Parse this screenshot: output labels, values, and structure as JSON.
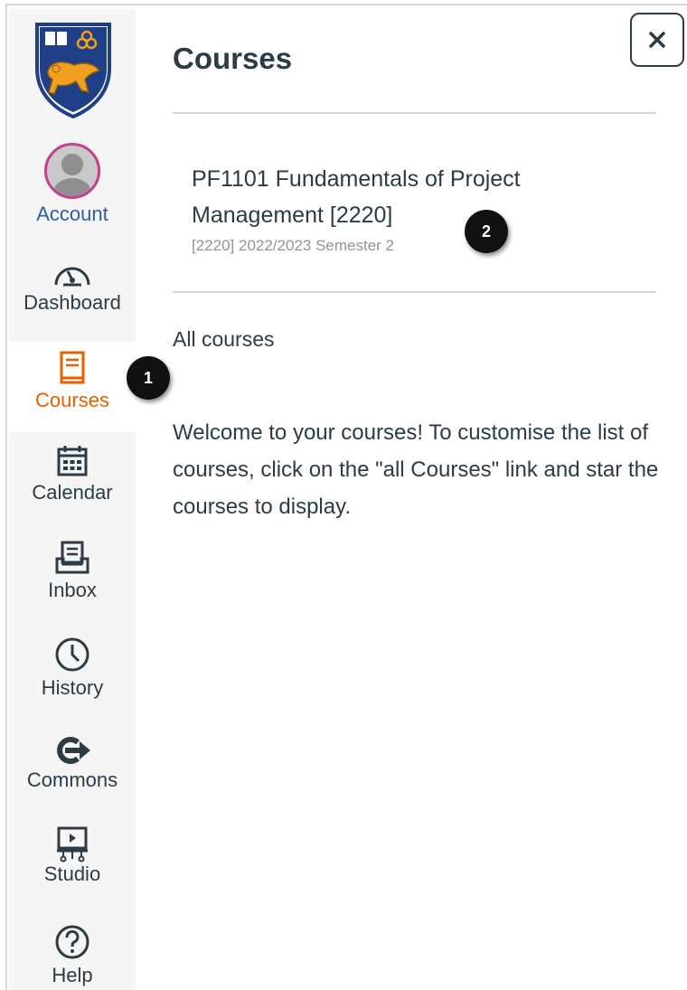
{
  "nav": {
    "account": "Account",
    "dashboard": "Dashboard",
    "courses": "Courses",
    "calendar": "Calendar",
    "inbox": "Inbox",
    "history": "History",
    "commons": "Commons",
    "studio": "Studio",
    "help": "Help"
  },
  "panel": {
    "title": "Courses",
    "close_symbol": "×",
    "course": {
      "name": "PF1101 Fundamentals of Project Management [2220]",
      "term": "[2220] 2022/2023 Semester 2"
    },
    "all_courses": "All courses",
    "welcome": "Welcome to your courses! To customise the list of courses, click on the \"all Courses\" link and star the courses to display."
  },
  "callouts": {
    "first": "1",
    "second": "2"
  },
  "colors": {
    "active": "#e66000",
    "text": "#2d3b45",
    "avatar_ring": "#c2418c"
  },
  "icons": [
    "university-crest-logo",
    "user-avatar-icon",
    "dashboard-speedometer-icon",
    "courses-book-icon",
    "calendar-icon",
    "inbox-icon",
    "history-clock-icon",
    "commons-arrow-icon",
    "studio-screen-icon",
    "help-question-icon",
    "close-icon"
  ]
}
